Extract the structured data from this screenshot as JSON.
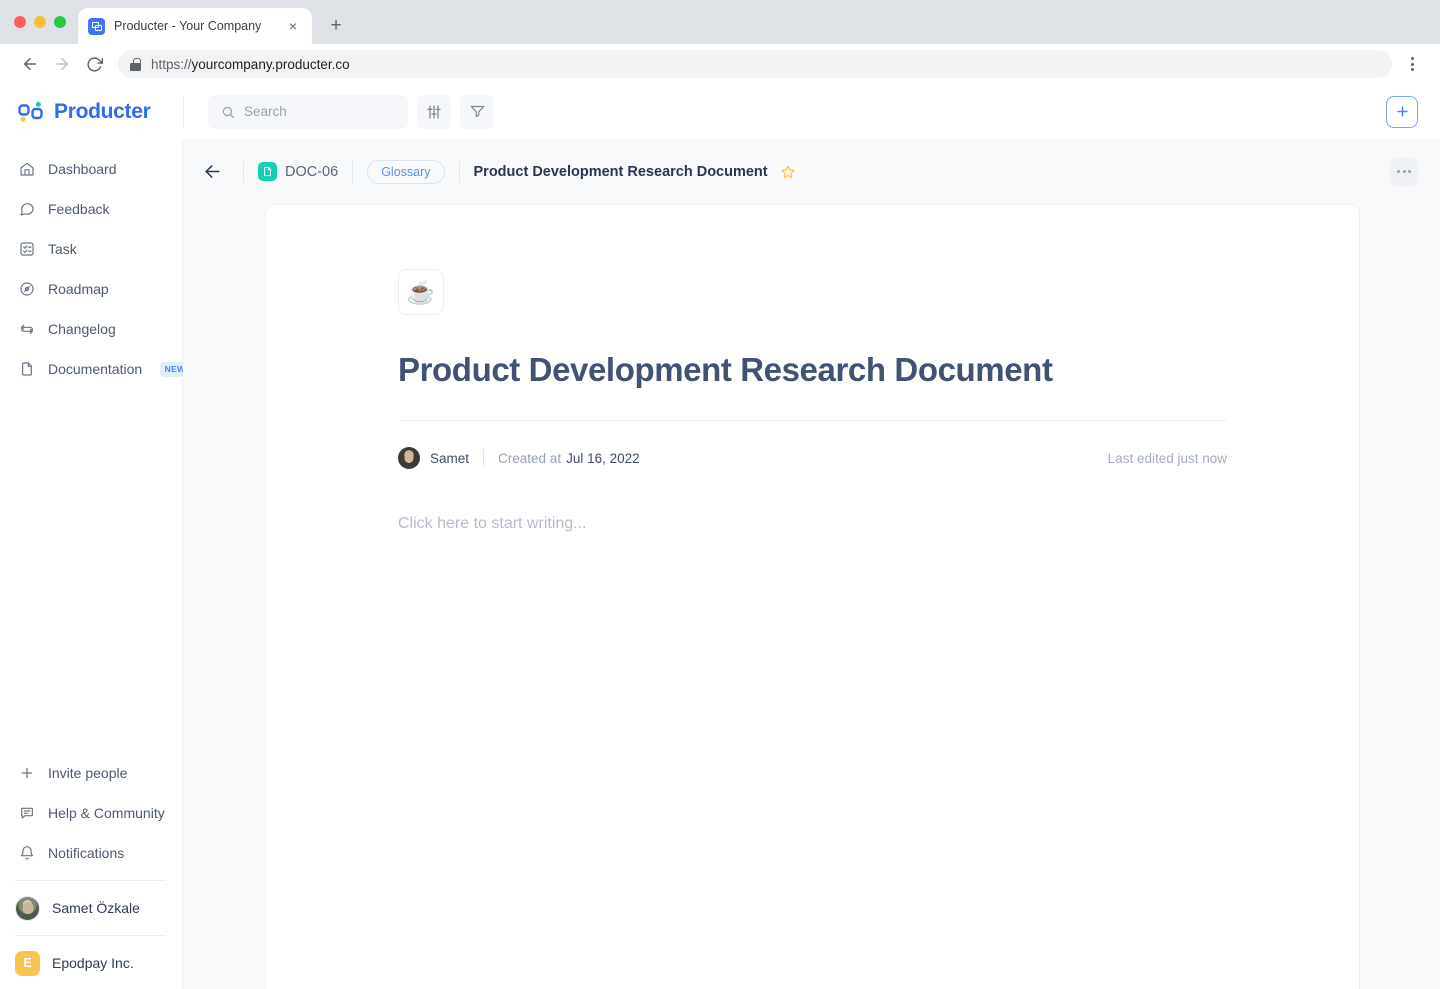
{
  "browser": {
    "tab_title": "Producter - Your Company",
    "tab_favicon_icon": "producter-logo-icon",
    "close_tab_label": "×",
    "new_tab_label": "+",
    "back_icon": "arrow-left-icon",
    "forward_icon": "arrow-right-icon",
    "reload_icon": "reload-icon",
    "lock_icon": "lock-icon",
    "url_scheme": "https://",
    "url_host": "yourcompany.producter.co",
    "menu_icon": "kebab-vertical-icon"
  },
  "header": {
    "brand_name": "Producter",
    "logo_icon": "producter-logo-icon",
    "search": {
      "icon": "search-icon",
      "placeholder": "Search",
      "value": ""
    },
    "sliders_button_icon": "sliders-icon",
    "filter_button_icon": "filter-icon",
    "add_button_icon": "plus-icon",
    "add_button_label": "+"
  },
  "sidebar": {
    "items": [
      {
        "label": "Dashboard",
        "icon": "home-icon",
        "badge": ""
      },
      {
        "label": "Feedback",
        "icon": "chat-bubble-icon",
        "badge": ""
      },
      {
        "label": "Task",
        "icon": "checklist-icon",
        "badge": ""
      },
      {
        "label": "Roadmap",
        "icon": "compass-icon",
        "badge": ""
      },
      {
        "label": "Changelog",
        "icon": "refresh-loop-icon",
        "badge": ""
      },
      {
        "label": "Documentation",
        "icon": "file-icon",
        "badge": "NEW"
      }
    ],
    "bottom_items": [
      {
        "label": "Invite people",
        "icon": "plus-icon"
      },
      {
        "label": "Help & Community",
        "icon": "message-square-icon"
      },
      {
        "label": "Notifications",
        "icon": "bell-icon"
      }
    ],
    "user": {
      "name": "Samet Özkale",
      "avatar_icon": "user-avatar"
    },
    "workspace": {
      "name": "Epodpay Inc.",
      "initial": "E",
      "color": "#fbc452"
    }
  },
  "doc_topbar": {
    "back_icon": "arrow-left-icon",
    "doc_code": "DOC-06",
    "doc_code_icon": "document-icon",
    "doc_code_color": "#10d1b2",
    "tag": "Glossary",
    "title": "Product Development Research Document",
    "star_icon": "star-outline-icon",
    "more_icon": "kebab-horizontal-icon"
  },
  "document": {
    "emoji": "☕",
    "emoji_name": "coffee-cup-emoji",
    "title": "Product Development Research Document",
    "author": "Samet",
    "created_label": "Created at",
    "created_date": "Jul 16, 2022",
    "last_edited": "Last edited just now",
    "body_placeholder": "Click here to start writing..."
  },
  "colors": {
    "brand_blue": "#2f6bf0",
    "accent_teal": "#10d1b2",
    "accent_yellow": "#fbc452",
    "text_dark": "#2a3550",
    "title_color": "#415275",
    "bg_canvas": "#f8f9fb"
  }
}
